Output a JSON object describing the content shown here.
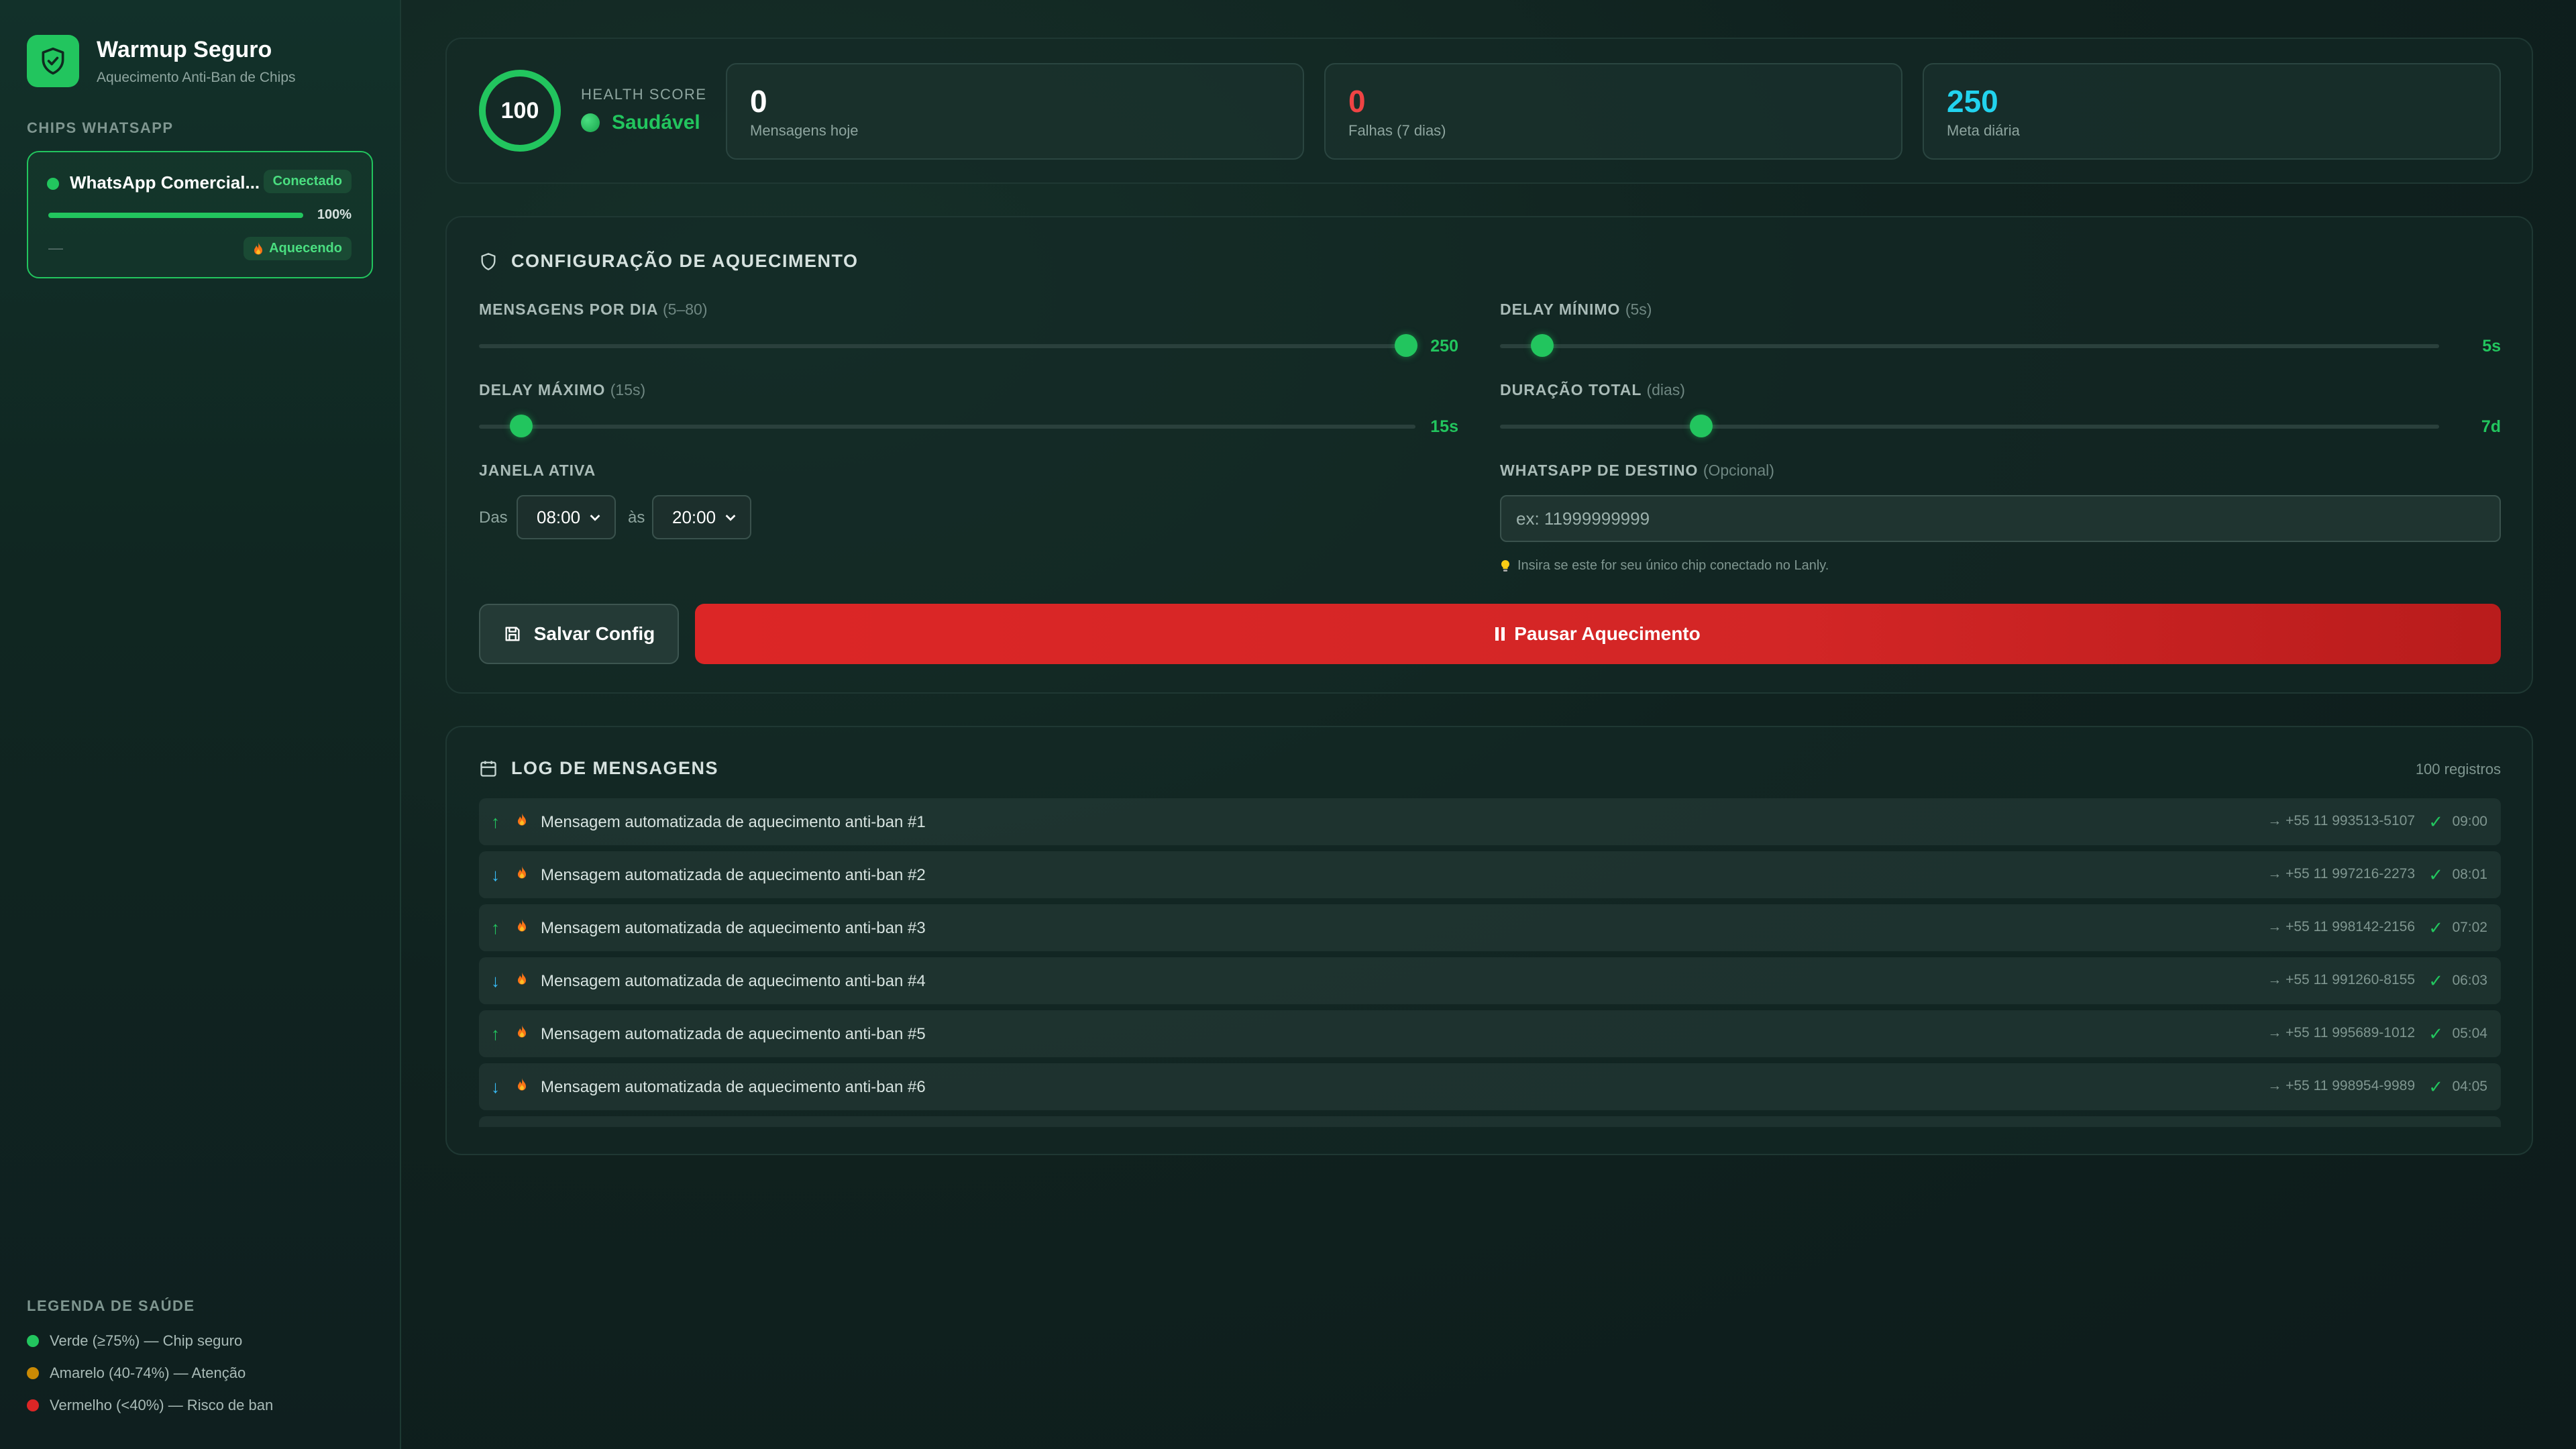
{
  "brand": {
    "title": "Warmup Seguro",
    "subtitle": "Aquecimento Anti-Ban de Chips"
  },
  "sidebar": {
    "chips_label": "CHIPS WHATSAPP",
    "chip": {
      "name": "WhatsApp Comercial...",
      "badge": "Conectado",
      "progress_percent": 100,
      "progress_label": "100%",
      "secondary": "—",
      "status": "Aquecendo"
    },
    "legend_label": "LEGENDA DE SAÚDE",
    "legend": [
      {
        "text": "Verde (≥75%) — Chip seguro",
        "color": "#22c55e"
      },
      {
        "text": "Amarelo (40-74%) — Atenção",
        "color": "#ca8a04"
      },
      {
        "text": "Vermelho (<40%) — Risco de ban",
        "color": "#dc2626"
      }
    ]
  },
  "health": {
    "score": "100",
    "score_percent": 100,
    "label": "HEALTH SCORE",
    "status": "Saudável"
  },
  "stats": [
    {
      "value": "0",
      "label": "Mensagens hoje",
      "color": "#ffffff"
    },
    {
      "value": "0",
      "label": "Falhas (7 dias)",
      "color": "#ef4444"
    },
    {
      "value": "250",
      "label": "Meta diária",
      "color": "#22d3ee"
    }
  ],
  "config": {
    "title": "CONFIGURAÇÃO DE AQUECIMENTO",
    "messages_per_day": {
      "label": "MENSAGENS POR DIA",
      "hint": "(5–80)",
      "value": "250",
      "fraction": 0.99
    },
    "delay_min": {
      "label": "DELAY MÍNIMO",
      "hint": "(5s)",
      "value": "5s",
      "fraction": 0.045
    },
    "delay_max": {
      "label": "DELAY MÁXIMO",
      "hint": "(15s)",
      "value": "15s",
      "fraction": 0.045
    },
    "duration": {
      "label": "DURAÇÃO TOTAL",
      "hint": "(dias)",
      "value": "7d",
      "fraction": 0.214
    },
    "window": {
      "label": "JANELA ATIVA",
      "from_text": "Das",
      "from": "08:00",
      "to_text": "às",
      "to": "20:00"
    },
    "destination": {
      "label": "WHATSAPP DE DESTINO",
      "hint": "(Opcional)",
      "placeholder": "ex: 11999999999",
      "tip": "Insira se este for seu único chip conectado no Lanly."
    },
    "save_label": "Salvar Config",
    "pause_label": "Pausar Aquecimento"
  },
  "log": {
    "title": "LOG DE MENSAGENS",
    "count": "100 registros",
    "colors": {
      "out": "#22c55e",
      "in": "#38bdf8"
    },
    "items": [
      {
        "dir": "↑",
        "kind": "out",
        "text": "Mensagem automatizada de aquecimento anti-ban #1",
        "phone": "→ +55 11 993513-5107",
        "time": "09:00"
      },
      {
        "dir": "↓",
        "kind": "in",
        "text": "Mensagem automatizada de aquecimento anti-ban #2",
        "phone": "→ +55 11 997216-2273",
        "time": "08:01"
      },
      {
        "dir": "↑",
        "kind": "out",
        "text": "Mensagem automatizada de aquecimento anti-ban #3",
        "phone": "→ +55 11 998142-2156",
        "time": "07:02"
      },
      {
        "dir": "↓",
        "kind": "in",
        "text": "Mensagem automatizada de aquecimento anti-ban #4",
        "phone": "→ +55 11 991260-8155",
        "time": "06:03"
      },
      {
        "dir": "↑",
        "kind": "out",
        "text": "Mensagem automatizada de aquecimento anti-ban #5",
        "phone": "→ +55 11 995689-1012",
        "time": "05:04"
      },
      {
        "dir": "↓",
        "kind": "in",
        "text": "Mensagem automatizada de aquecimento anti-ban #6",
        "phone": "→ +55 11 998954-9989",
        "time": "04:05"
      }
    ]
  }
}
